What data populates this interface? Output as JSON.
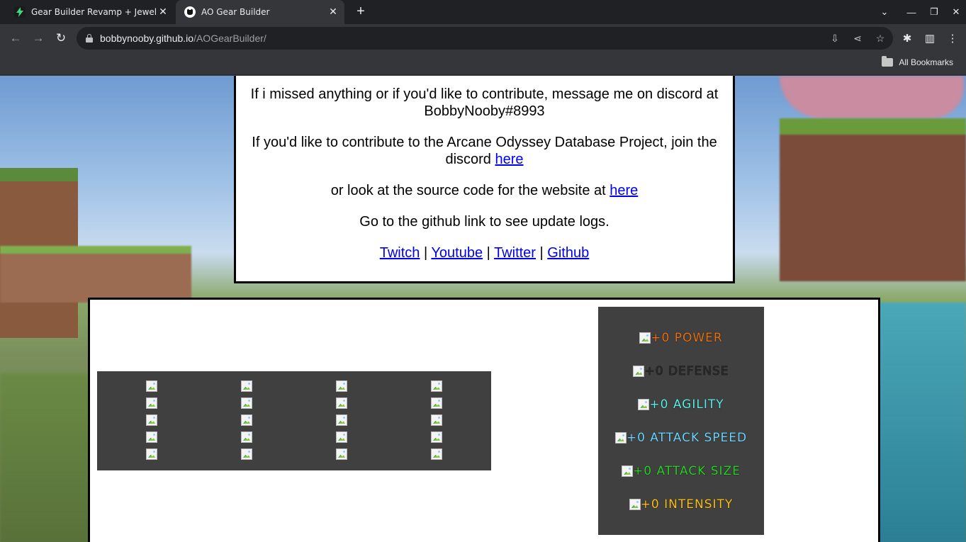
{
  "browser": {
    "tabs": [
      {
        "title": "Gear Builder Revamp + Jewels +",
        "active": false
      },
      {
        "title": "AO Gear Builder",
        "active": true
      }
    ],
    "url_host": "bobbynooby.github.io",
    "url_path": "/AOGearBuilder/",
    "bookmarks_label": "All Bookmarks"
  },
  "info": {
    "p1": "If i missed anything or if you'd like to contribute, message me on discord at BobbyNooby#8993",
    "p2_text": "If you'd like to contribute to the Arcane Odyssey Database Project, join the discord",
    "p2_link": "here",
    "p3_text": "or look at the source code for the website at",
    "p3_link": "here",
    "p4": "Go to the github link to see update logs.",
    "links": [
      "Twitch",
      "Youtube",
      "Twitter",
      "Github"
    ],
    "separator": "|"
  },
  "stats": [
    {
      "label": "+0 POWER",
      "color": "#e8751a"
    },
    {
      "label": "+0 DEFENSE",
      "color": "#2b2b2b"
    },
    {
      "label": "+0 AGILITY",
      "color": "#5ff0e8"
    },
    {
      "label": "+0 ATTACK SPEED",
      "color": "#6fd6ff"
    },
    {
      "label": "+0 ATTACK SIZE",
      "color": "#2fd02f"
    },
    {
      "label": "+0 INTENSITY",
      "color": "#ffc21a"
    }
  ],
  "colors": {
    "panel_bg": "#404040",
    "link": "#0000ee"
  }
}
